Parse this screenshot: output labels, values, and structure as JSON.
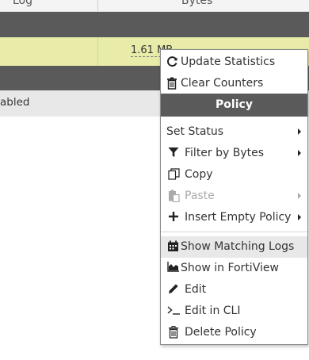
{
  "table": {
    "header_left": "Log",
    "header_bytes": "Bytes",
    "row_bytes": "1.61 MB",
    "row_status": "abled"
  },
  "menu": {
    "update_statistics": "Update Statistics",
    "clear_counters": "Clear Counters",
    "policy_header": "Policy",
    "set_status": "Set Status",
    "filter_by_bytes": "Filter by Bytes",
    "copy": "Copy",
    "paste": "Paste",
    "insert_empty_policy": "Insert Empty Policy",
    "show_matching_logs": "Show Matching Logs",
    "show_in_fortiview": "Show in FortiView",
    "edit": "Edit",
    "edit_in_cli": "Edit in CLI",
    "delete_policy": "Delete Policy"
  },
  "icons": {
    "update_statistics": "refresh-icon",
    "clear_counters": "trash-icon",
    "filter_by_bytes": "filter-icon",
    "copy": "copy-icon",
    "paste": "paste-icon",
    "insert_empty_policy": "plus-icon",
    "show_matching_logs": "calendar-log-icon",
    "show_in_fortiview": "area-chart-icon",
    "edit": "pencil-icon",
    "edit_in_cli": "terminal-icon",
    "delete_policy": "trash-icon"
  },
  "colors": {
    "section_bar": "#5a5a5a",
    "selected_row": "#e8eca8",
    "menu_hover": "#e8e8e8",
    "disabled_text": "#aaaaaa"
  }
}
